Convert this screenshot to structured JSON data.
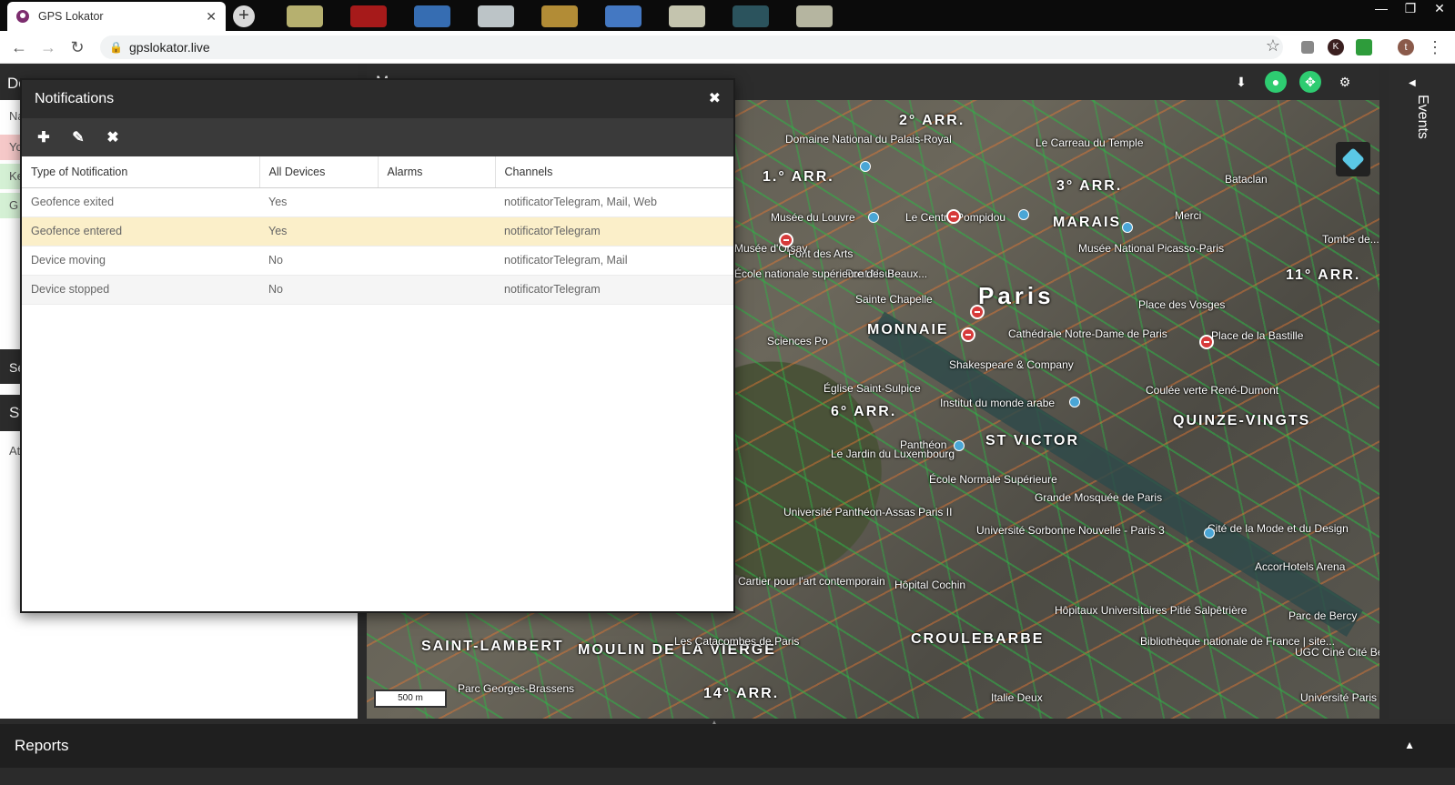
{
  "browser": {
    "tab_title": "GPS Lokator",
    "tab_close": "✕",
    "new_tab": "+",
    "url": "gpslokator.live",
    "back": "←",
    "forward": "→",
    "reload": "↻",
    "star": "☆",
    "menu": "⋮",
    "profile_initial": "t",
    "ext_k": "K",
    "window_controls": {
      "minimize": "—",
      "restore": "❐",
      "close": "✕"
    }
  },
  "left_panel": {
    "header_partial": "De",
    "strip_rows": [
      "Na",
      "Yo",
      "Ke",
      "G"
    ],
    "search_partial": "Se",
    "state_header_partial": "St",
    "state_row_partial": "At"
  },
  "map": {
    "header_partial": "M",
    "labels": [
      "2° ARR.",
      "Domaine National du Palais-Royal",
      "Le Carreau du Temple",
      "1.° ARR.",
      "3° ARR.",
      "Musée du Louvre",
      "Le Centre Pompidou",
      "MARAIS",
      "Bataclan",
      "Merci",
      "Pont des Arts",
      "Musée National Picasso-Paris",
      "11° ARR.",
      "Pont Neuf",
      "Sainte Chapelle",
      "Paris",
      "MONNAIE",
      "Cathédrale Notre-Dame de Paris",
      "Place des Vosges",
      "Place de la Bastille",
      "Shakespeare & Company",
      "Église Saint-Sulpice",
      "Institut du monde arabe",
      "Coulée verte René-Dumont",
      "6° ARR.",
      "QUINZE-VINGTS",
      "Panthéon",
      "ST VICTOR",
      "Le Jardin du Luxembourg",
      "École Normale Supérieure",
      "Grande Mosquée de Paris",
      "Université Panthéon-Assas Paris II",
      "Université Sorbonne Nouvelle - Paris 3",
      "Cité de la Mode et du Design",
      "AccorHotels Arena",
      "Hôpital Cochin",
      "Hôpitaux Universitaires Pitié Salpêtrière",
      "Parc de Bercy",
      "SAINT-LAMBERT",
      "MOULIN DE LA VIERGE",
      "Les Catacombes de Paris",
      "CROULEBARBE",
      "Bibliothèque nationale de France | site...",
      "UGC Ciné Cité Bercy",
      "14° ARR.",
      "Italie Deux",
      "Université Paris Diderot",
      "Sciences Po",
      "École nationale supérieure des Beaux...",
      "Musée d'Orsay",
      "Cartier pour l'art contemporain",
      "Parc Georges-Brassens",
      "Tombe de..."
    ],
    "scale": "500 m"
  },
  "events_label": "Events",
  "reports_label": "Reports",
  "notifications_dialog": {
    "title": "Notifications",
    "close": "✖",
    "toolbar": {
      "add": "✚",
      "edit": "✎",
      "remove": "✖"
    },
    "columns": [
      "Type of Notification",
      "All Devices",
      "Alarms",
      "Channels"
    ],
    "rows": [
      {
        "type": "Geofence exited",
        "all_devices": "Yes",
        "alarms": "",
        "channels": "notificatorTelegram, Mail, Web"
      },
      {
        "type": "Geofence entered",
        "all_devices": "Yes",
        "alarms": "",
        "channels": "notificatorTelegram"
      },
      {
        "type": "Device moving",
        "all_devices": "No",
        "alarms": "",
        "channels": "notificatorTelegram, Mail"
      },
      {
        "type": "Device stopped",
        "all_devices": "No",
        "alarms": "",
        "channels": "notificatorTelegram"
      }
    ],
    "selected_row_index": 1
  },
  "colors": {
    "selected_row": "#fbefc9",
    "accent_green": "#2ecc71",
    "header_dark": "#2c2c2c"
  }
}
